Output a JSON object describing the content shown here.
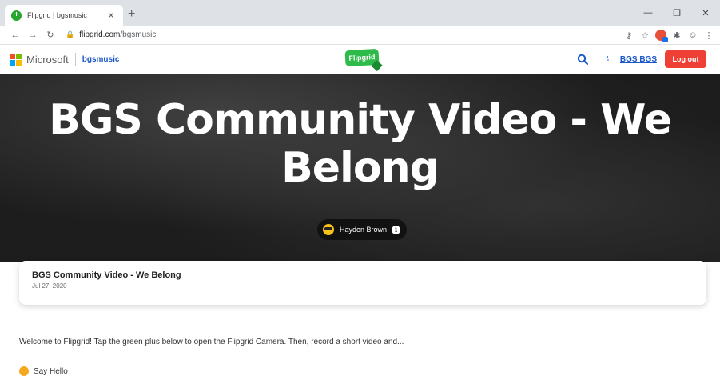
{
  "browser": {
    "tab_title": "Flipgrid | bgsmusic",
    "url_host": "flipgrid.com",
    "url_path": "/bgsmusic"
  },
  "header": {
    "brand": "Microsoft",
    "group_name": "bgsmusic",
    "logo_text": "Flipgrid",
    "user_name": "BGS BGS",
    "logout_label": "Log out"
  },
  "hero": {
    "title": "BGS Community Video - We Belong",
    "author": "Hayden Brown"
  },
  "topic": {
    "title": "BGS Community Video - We Belong",
    "date": "Jul 27, 2020",
    "description": "Welcome to Flipgrid! Tap the green plus below to open the Flipgrid Camera. Then, record a short video and...",
    "say_hello": "Say Hello"
  },
  "colors": {
    "logout": "#ee4035",
    "flipgrid_green": "#2ebb4a",
    "link_blue": "#1a57c8"
  }
}
